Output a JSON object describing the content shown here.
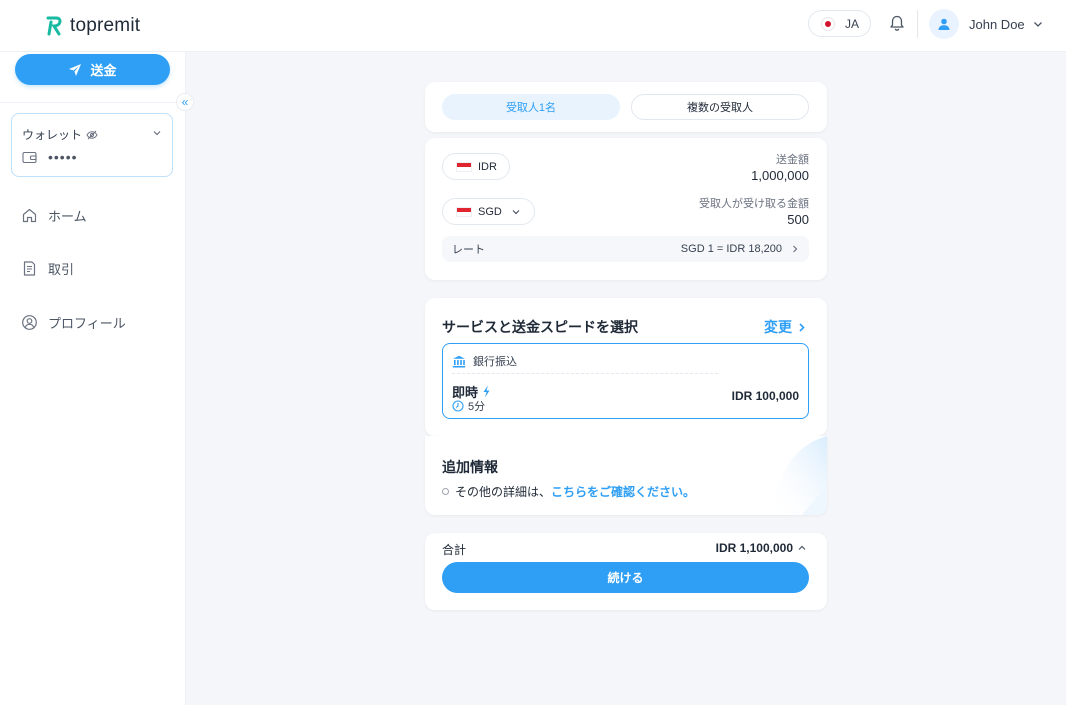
{
  "colors": {
    "accent": "#2f9ff5",
    "accent_light": "#e8f3fd",
    "page_bg": "#f4f6f9"
  },
  "header": {
    "brand": "topremit",
    "language": "JA",
    "user_name": "John Doe"
  },
  "sidebar": {
    "send_label": "送金",
    "collapse_glyph": "«",
    "wallet": {
      "title": "ウォレット",
      "balance_masked": "•••••"
    },
    "nav": [
      {
        "label": "ホーム",
        "icon": "home-icon"
      },
      {
        "label": "取引",
        "icon": "receipt-icon"
      },
      {
        "label": "プロフィール",
        "icon": "user-circle-icon"
      }
    ]
  },
  "recipient_tabs": {
    "single": "受取人1名",
    "multiple": "複数の受取人",
    "selected": "single"
  },
  "amount": {
    "send_currency": "IDR",
    "send_label": "送金額",
    "send_value": "1,000,000",
    "receive_currency": "SGD",
    "receive_label": "受取人が受け取る金額",
    "receive_value": "500",
    "rate_label": "レート",
    "rate_value": "SGD 1 = IDR 18,200"
  },
  "service": {
    "title": "サービスと送金スピードを選択",
    "change_label": "変更",
    "method": "銀行振込",
    "speed": "即時",
    "duration": "5分",
    "fee": "IDR 100,000"
  },
  "extra": {
    "title": "追加情報",
    "text_prefix": "その他の詳細は、",
    "link_text": "こちらをご確認ください。"
  },
  "summary": {
    "total_label": "合計",
    "total_value": "IDR 1,100,000",
    "continue_label": "続ける"
  }
}
